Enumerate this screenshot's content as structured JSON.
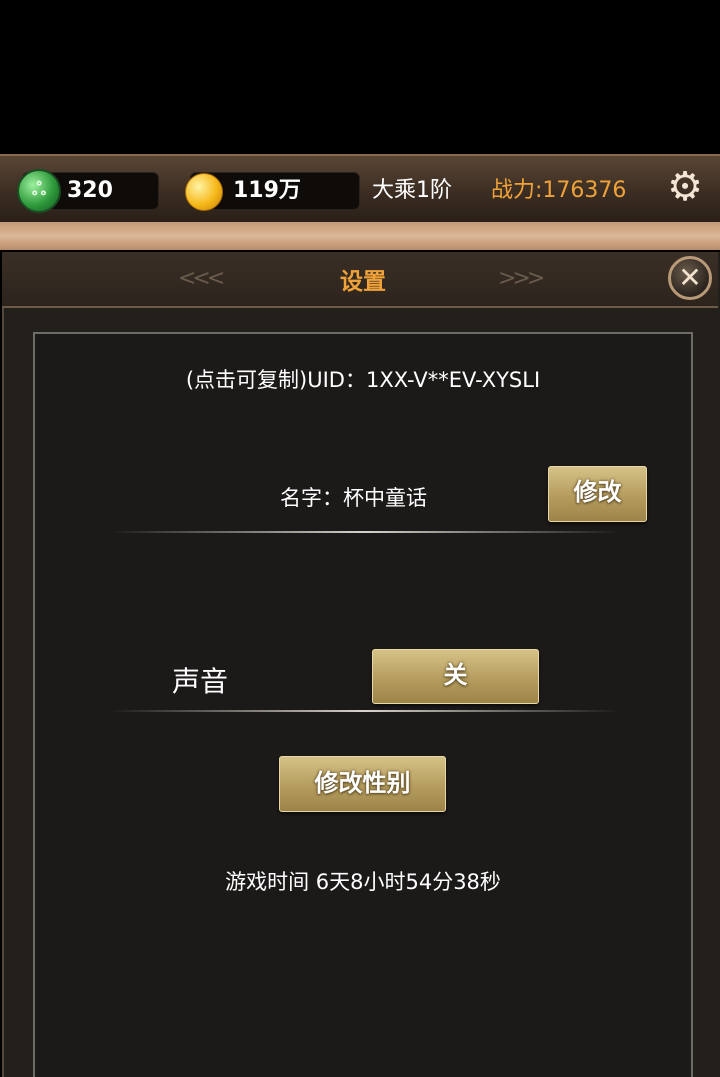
{
  "topbar": {
    "jade_count": "320",
    "gold_count": "119万",
    "realm": "大乘1阶",
    "power": "战力:176376",
    "jade_icon": "jade-icon",
    "gold_icon": "gold-coin-icon",
    "settings_icon": "gear-icon"
  },
  "panel": {
    "title": "设置",
    "close_icon": "close-icon",
    "uid_text": "(点击可复制)UID：1XX-V**EV-XYSLI",
    "name_text": "名字：杯中童话",
    "edit_name_label": "修改",
    "sound_label": "声音",
    "sound_toggle_label": "关",
    "edit_gender_label": "修改性别",
    "play_time": "游戏时间 6天8小时54分38秒"
  },
  "colors": {
    "accent_orange": "#f0a23a",
    "button_gold": "#b59c5e",
    "panel_bg": "#1c1a19"
  }
}
